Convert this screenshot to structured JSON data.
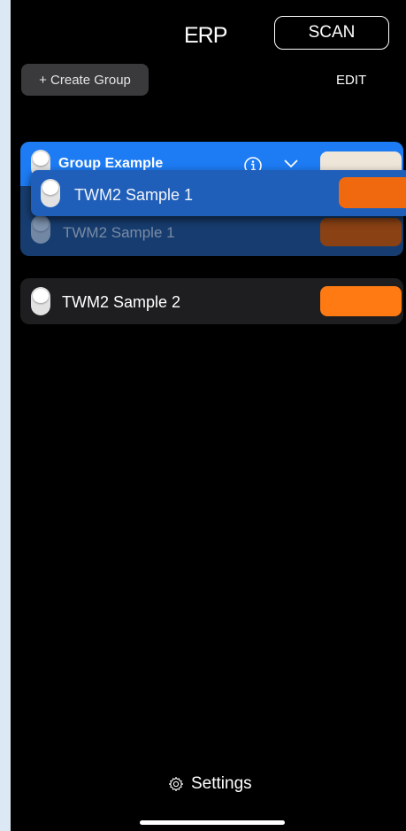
{
  "header": {
    "logo": "ERP",
    "scan_label": "SCAN",
    "create_group_label": "+ Create Group",
    "edit_label": "EDIT"
  },
  "group": {
    "title": "Group Example",
    "info_icon": "info-circle-icon",
    "chevron_icon": "chevron-down-icon",
    "swatch_color": "#efe6da",
    "member_label": "TWM2 Sample 1",
    "member_swatch_color": "#8a4114"
  },
  "dragged_row": {
    "label": "TWM2 Sample 1",
    "swatch_color": "#f0690f"
  },
  "devices": [
    {
      "label": "TWM2 Sample 2",
      "swatch_color": "#ff7a12"
    }
  ],
  "footer": {
    "settings_icon": "gear-icon",
    "settings_label": "Settings"
  },
  "colors": {
    "accent_blue": "#1d7bf3",
    "background": "#000000"
  }
}
